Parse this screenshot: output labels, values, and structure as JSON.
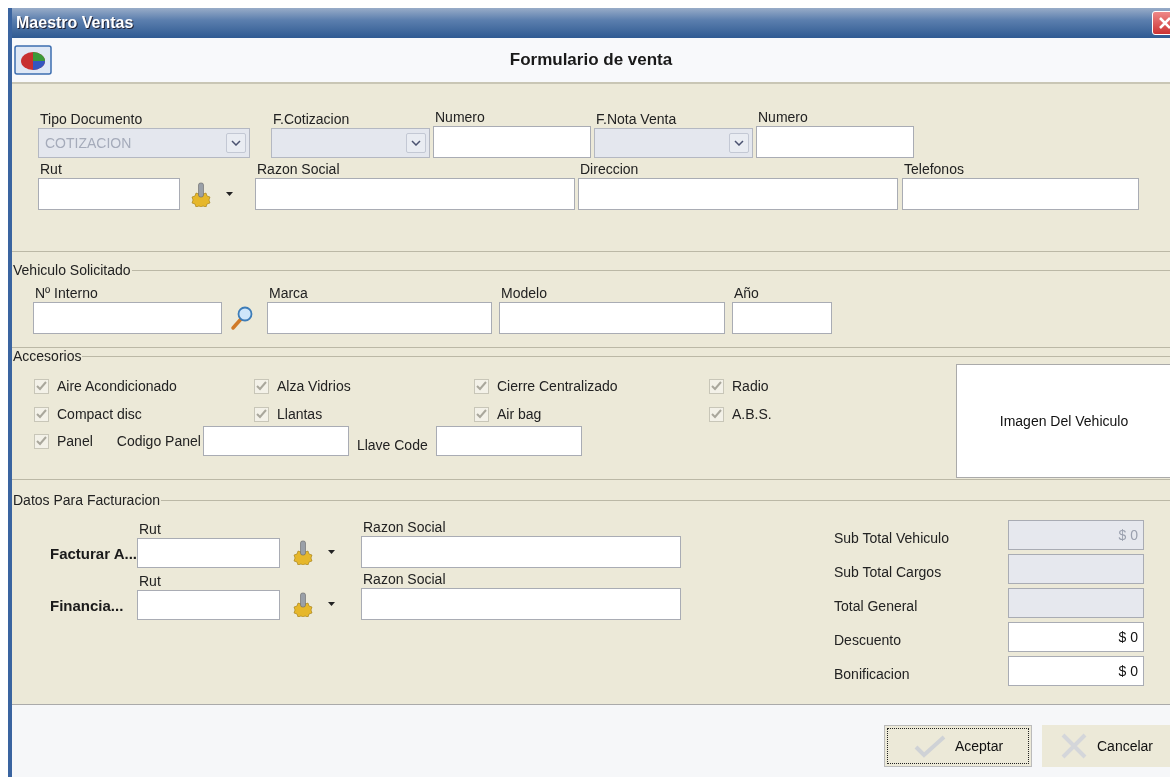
{
  "window": {
    "title": "Maestro Ventas"
  },
  "header": {
    "title": "Formulario de venta"
  },
  "document": {
    "row_1": [
      {
        "kind": "select",
        "label": "Tipo Documento",
        "value": "COTIZACION",
        "disabled": true
      },
      {
        "kind": "select",
        "label": "F.Cotizacion",
        "disabled": true
      },
      {
        "kind": "text",
        "label": "Numero"
      },
      {
        "kind": "select",
        "label": "F.Nota Venta",
        "disabled": true
      },
      {
        "kind": "text",
        "label": "Numero"
      }
    ],
    "row_2": [
      {
        "kind": "lookup",
        "label": "Rut"
      },
      {
        "kind": "text",
        "label": "Razon Social"
      },
      {
        "kind": "text",
        "label": "Direccion"
      },
      {
        "kind": "text",
        "label": "Telefonos"
      }
    ]
  },
  "vehicle": {
    "title": "Vehiculo Solicitado",
    "fields": [
      {
        "kind": "search",
        "label": "Nº Interno"
      },
      {
        "kind": "text",
        "label": "Marca"
      },
      {
        "kind": "text",
        "label": "Modelo"
      },
      {
        "kind": "text",
        "label": "Año"
      }
    ]
  },
  "accessories": {
    "title": "Accesorios",
    "items": [
      {
        "label": "Aire Acondicionado",
        "checked": true,
        "disabled": true
      },
      {
        "label": "Alza Vidrios",
        "checked": true,
        "disabled": true
      },
      {
        "label": "Cierre Centralizado",
        "checked": true,
        "disabled": true
      },
      {
        "label": "Radio",
        "checked": true,
        "disabled": true
      },
      {
        "label": "Compact disc",
        "checked": true,
        "disabled": true
      },
      {
        "label": "Llantas",
        "checked": true,
        "disabled": true
      },
      {
        "label": "Air bag",
        "checked": true,
        "disabled": true
      },
      {
        "label": "A.B.S.",
        "checked": true,
        "disabled": true
      }
    ],
    "panel": {
      "label": "Panel",
      "checked": true,
      "disabled": true
    },
    "panel_code": {
      "label": "Codigo Panel"
    },
    "key_code": {
      "label": "Llave Code"
    },
    "image": {
      "text": "Imagen Del Vehiculo"
    }
  },
  "billing": {
    "title": "Datos Para Facturacion",
    "rows": [
      {
        "label": "Facturar A...",
        "rut_label": "Rut",
        "name_label": "Razon Social"
      },
      {
        "label": "Financia...",
        "rut_label": "Rut",
        "name_label": "Razon Social"
      }
    ],
    "totals": [
      {
        "label": "Sub Total Vehiculo",
        "value": "$ 0",
        "disabled": true
      },
      {
        "label": "Sub Total Cargos",
        "disabled": true
      },
      {
        "label": "Total General",
        "disabled": true
      },
      {
        "label": "Descuento",
        "value": "$ 0",
        "disabled": false
      },
      {
        "label": "Bonificacion",
        "value": "$ 0",
        "disabled": false
      }
    ]
  },
  "buttons": [
    {
      "kind": "accept",
      "label": "Aceptar",
      "focused": true
    },
    {
      "kind": "cancel",
      "label": "Cancelar",
      "focused": false
    }
  ]
}
